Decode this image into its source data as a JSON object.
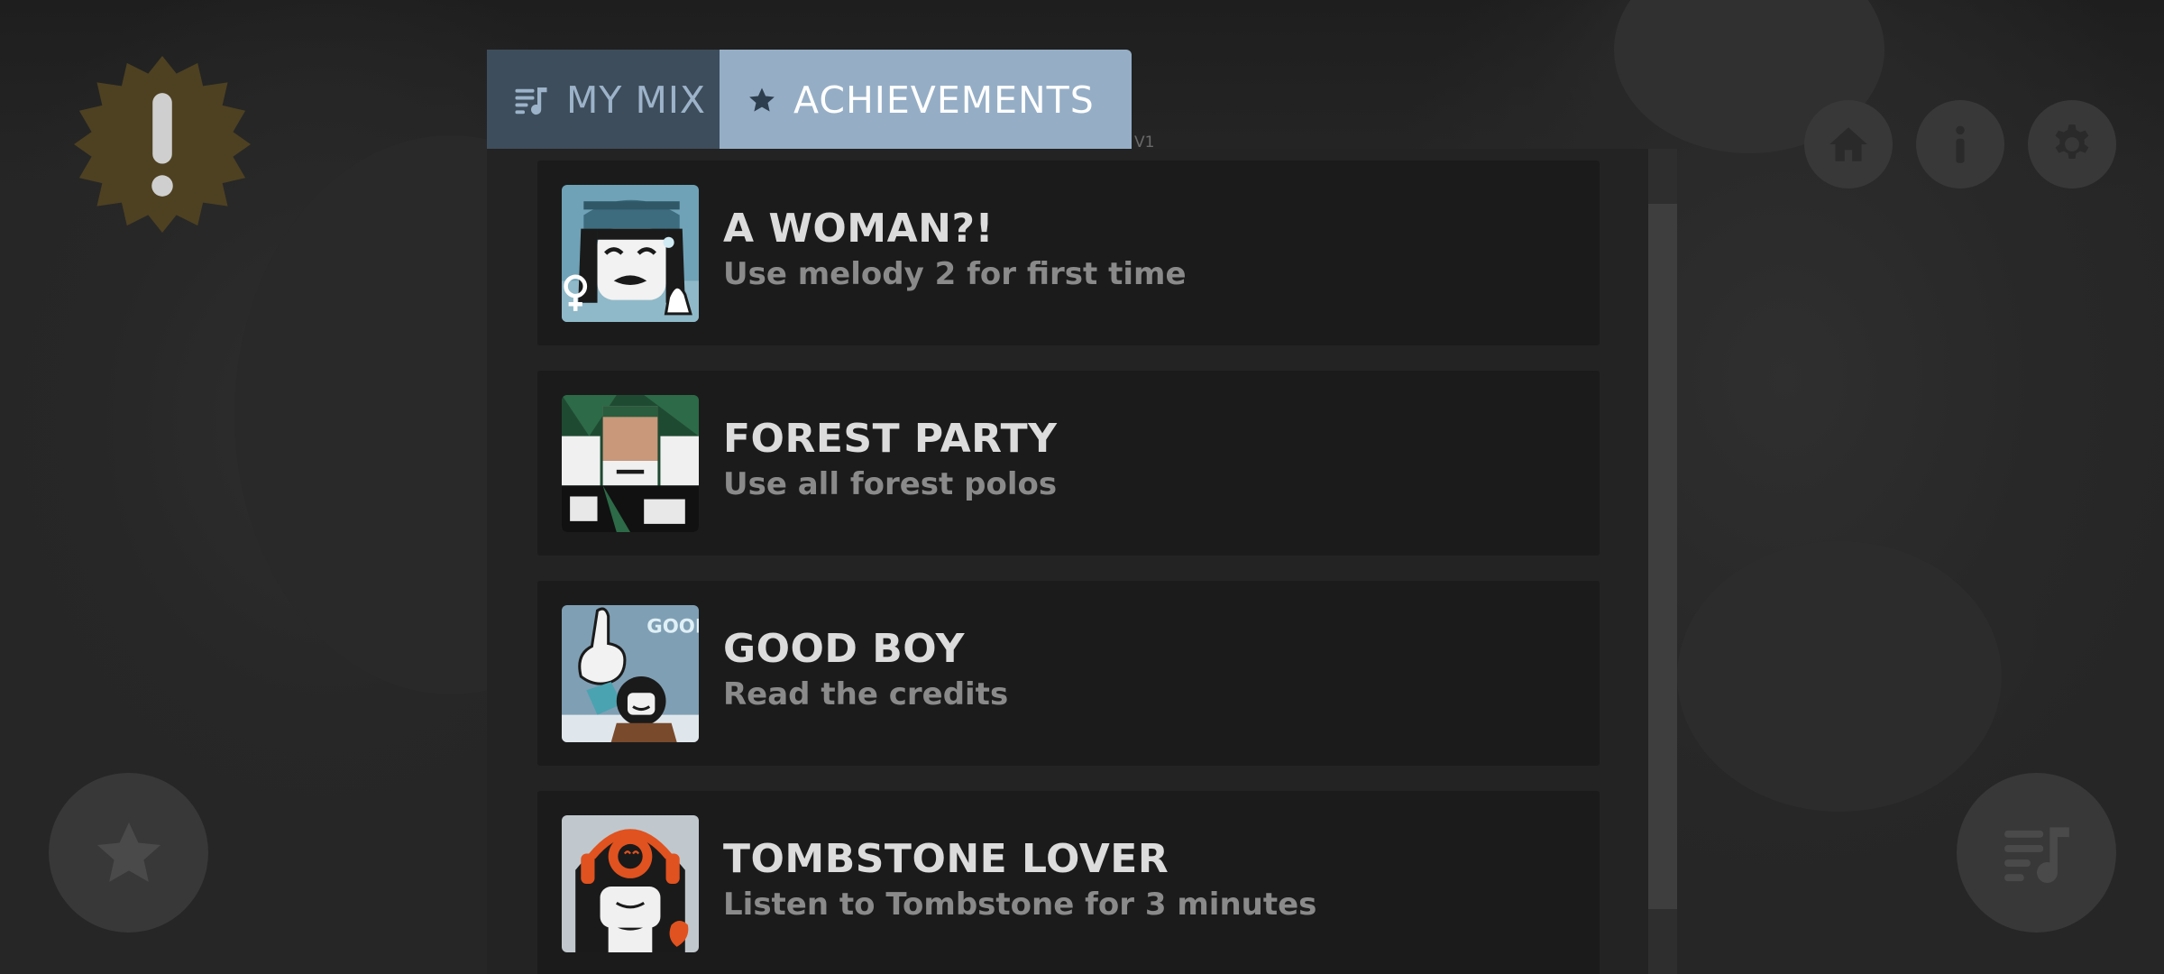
{
  "tabs": [
    {
      "label": "MY MIX",
      "icon": "playlist-music-icon",
      "active": false
    },
    {
      "label": "ACHIEVEMENTS",
      "icon": "star-icon",
      "active": true
    }
  ],
  "version": "V1",
  "top_buttons": [
    "home-icon",
    "info-icon",
    "gear-icon"
  ],
  "bottom_buttons": [
    "star-icon",
    "playlist-music-icon"
  ],
  "colors": {
    "active_tab": "#95aec6",
    "inactive_tab": "#3d4d5b",
    "alert_badge": "#4e4121",
    "background": "#262626"
  },
  "achievements": [
    {
      "title": "A WOMAN?!",
      "description": "Use melody 2 for first time"
    },
    {
      "title": "FOREST PARTY",
      "description": "Use all forest polos"
    },
    {
      "title": "GOOD BOY",
      "description": "Read the credits"
    },
    {
      "title": "TOMBSTONE LOVER",
      "description": "Listen to Tombstone for 3 minutes"
    }
  ],
  "image_text": {
    "good_boy": "GOOD BOY"
  }
}
